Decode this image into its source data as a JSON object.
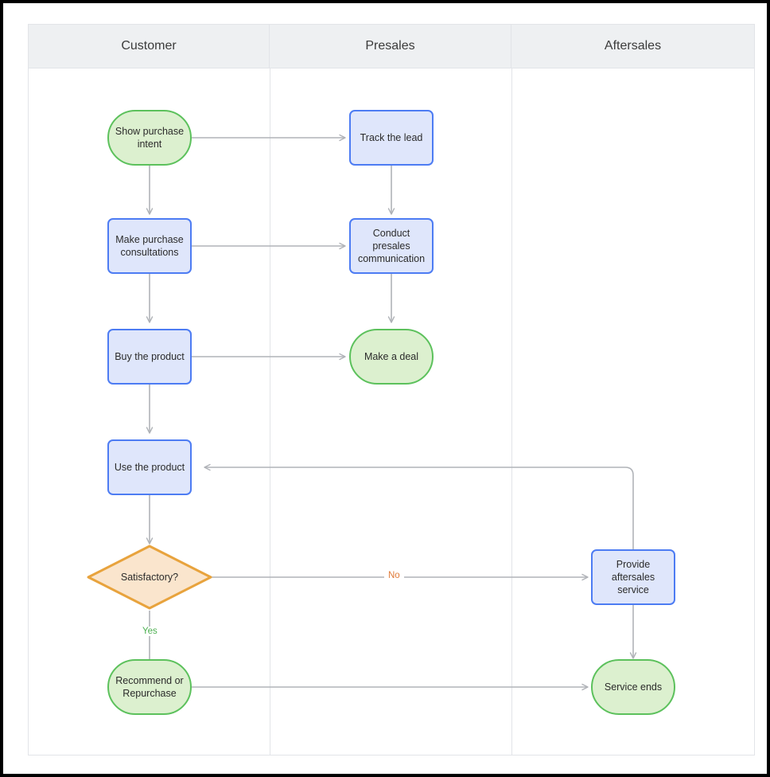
{
  "diagram": {
    "type": "swimlane-flowchart",
    "colors": {
      "process_fill": "#dfe6fb",
      "process_border": "#4d7cf3",
      "terminal_fill": "#dcf0cf",
      "terminal_border": "#5cc15c",
      "decision_fill": "#fae5cd",
      "decision_border": "#e8a33d",
      "connector": "#b0b3b8",
      "lane_header_bg": "#eef0f2",
      "lane_border": "#e2e4e8",
      "label_no": "#e07b39",
      "label_yes": "#4caf50"
    },
    "lanes": [
      {
        "id": "customer",
        "title": "Customer"
      },
      {
        "id": "presales",
        "title": "Presales"
      },
      {
        "id": "aftersales",
        "title": "Aftersales"
      }
    ],
    "nodes": [
      {
        "id": "show-purchase-intent",
        "lane": "customer",
        "shape": "terminal",
        "label": "Show purchase intent"
      },
      {
        "id": "track-the-lead",
        "lane": "presales",
        "shape": "process",
        "label": "Track the lead"
      },
      {
        "id": "make-purchase-consultations",
        "lane": "customer",
        "shape": "process",
        "label": "Make purchase consultations"
      },
      {
        "id": "conduct-presales-communication",
        "lane": "presales",
        "shape": "process",
        "label": "Conduct presales communication"
      },
      {
        "id": "buy-the-product",
        "lane": "customer",
        "shape": "process",
        "label": "Buy the product"
      },
      {
        "id": "make-a-deal",
        "lane": "presales",
        "shape": "terminal",
        "label": "Make a deal"
      },
      {
        "id": "use-the-product",
        "lane": "customer",
        "shape": "process",
        "label": "Use the product"
      },
      {
        "id": "satisfactory",
        "lane": "customer",
        "shape": "decision",
        "label": "Satisfactory?"
      },
      {
        "id": "provide-aftersales-service",
        "lane": "aftersales",
        "shape": "process",
        "label": "Provide aftersales service"
      },
      {
        "id": "recommend-or-repurchase",
        "lane": "customer",
        "shape": "terminal",
        "label": "Recommend or Repurchase"
      },
      {
        "id": "service-ends",
        "lane": "aftersales",
        "shape": "terminal",
        "label": "Service ends"
      }
    ],
    "edges": [
      {
        "from": "show-purchase-intent",
        "to": "track-the-lead",
        "label": ""
      },
      {
        "from": "show-purchase-intent",
        "to": "make-purchase-consultations",
        "label": ""
      },
      {
        "from": "track-the-lead",
        "to": "conduct-presales-communication",
        "label": ""
      },
      {
        "from": "make-purchase-consultations",
        "to": "conduct-presales-communication",
        "label": ""
      },
      {
        "from": "make-purchase-consultations",
        "to": "buy-the-product",
        "label": ""
      },
      {
        "from": "conduct-presales-communication",
        "to": "make-a-deal",
        "label": ""
      },
      {
        "from": "buy-the-product",
        "to": "make-a-deal",
        "label": ""
      },
      {
        "from": "buy-the-product",
        "to": "use-the-product",
        "label": ""
      },
      {
        "from": "use-the-product",
        "to": "satisfactory",
        "label": ""
      },
      {
        "from": "satisfactory",
        "to": "provide-aftersales-service",
        "label": "No"
      },
      {
        "from": "satisfactory",
        "to": "recommend-or-repurchase",
        "label": "Yes"
      },
      {
        "from": "provide-aftersales-service",
        "to": "use-the-product",
        "label": ""
      },
      {
        "from": "provide-aftersales-service",
        "to": "service-ends",
        "label": ""
      },
      {
        "from": "recommend-or-repurchase",
        "to": "service-ends",
        "label": ""
      }
    ],
    "edge_labels": {
      "no": "No",
      "yes": "Yes"
    }
  }
}
